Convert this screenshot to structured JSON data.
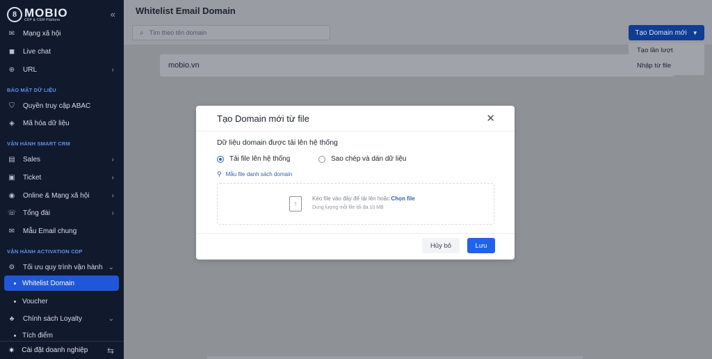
{
  "sidebar": {
    "logo_word": "MOBIO",
    "logo_sub": "CDP & CEM Platform",
    "collapse_glyph": "«",
    "items": [
      {
        "label": "Mạng xã hội",
        "icon": "megaphone-icon",
        "glyph": "✉"
      },
      {
        "label": "Live chat",
        "icon": "chat-icon",
        "glyph": "◼"
      },
      {
        "label": "URL",
        "icon": "globe-icon",
        "glyph": "⊕"
      }
    ],
    "section_security": "BẢO MẬT DỮ LIỆU",
    "security_items": [
      {
        "label": "Quyền truy cập ABAC",
        "icon": "shield-icon",
        "glyph": "⛉"
      },
      {
        "label": "Mã hóa dữ liệu",
        "icon": "layers-icon",
        "glyph": "◈"
      }
    ],
    "section_crm": "VẬN HÀNH SMART CRM",
    "crm_items": [
      {
        "label": "Sales",
        "icon": "sales-icon",
        "glyph": "▤"
      },
      {
        "label": "Ticket",
        "icon": "ticket-icon",
        "glyph": "▣"
      },
      {
        "label": "Online & Mạng xã hội",
        "icon": "social-icon",
        "glyph": "◉"
      },
      {
        "label": "Tổng đài",
        "icon": "phone-icon",
        "glyph": "☏"
      },
      {
        "label": "Mẫu Email chung",
        "icon": "mail-icon",
        "glyph": "✉"
      }
    ],
    "section_cdp": "VẬN HÀNH ACTIVATION CDP",
    "cdp_items": {
      "optimize": {
        "label": "Tối ưu quy trình vận hành",
        "icon": "gear-icon",
        "glyph": "⚙"
      },
      "whitelist": "Whitelist Domain",
      "voucher": "Voucher",
      "loyalty": {
        "label": "Chính sách Loyalty",
        "icon": "loyalty-icon",
        "glyph": "♣"
      },
      "points": "Tích điểm"
    },
    "footer": "Cài đặt doanh nghiệp"
  },
  "header": {
    "title": "Whitelist Email Domain",
    "search_placeholder": "Tìm theo tên domain",
    "create_button": "Tạo Domain mới",
    "dropdown": [
      "Tạo lần lượt",
      "Nhập từ file"
    ]
  },
  "domains": [
    "mobio.vn"
  ],
  "modal": {
    "title": "Tạo Domain mới từ file",
    "field_label": "Dữ liệu domain được tải lên hệ thống",
    "options": [
      {
        "label": "Tải file lên hệ thống",
        "selected": true
      },
      {
        "label": "Sao chép và dán dữ liệu",
        "selected": false
      }
    ],
    "template_link": "Mẫu file danh sách domain",
    "dropzone_text": "Kéo file vào đây để tải lên hoặc ",
    "dropzone_choose": "Chọn file",
    "dropzone_sub": "Dung lượng mỗi file tối đa 10 MB",
    "cancel": "Hủy bỏ",
    "save": "Lưu"
  },
  "colors": {
    "sidebar_bg": "#111a2d",
    "accent": "#1f62ee",
    "active_item": "#1f57d8",
    "section_label": "#5f8fef"
  }
}
